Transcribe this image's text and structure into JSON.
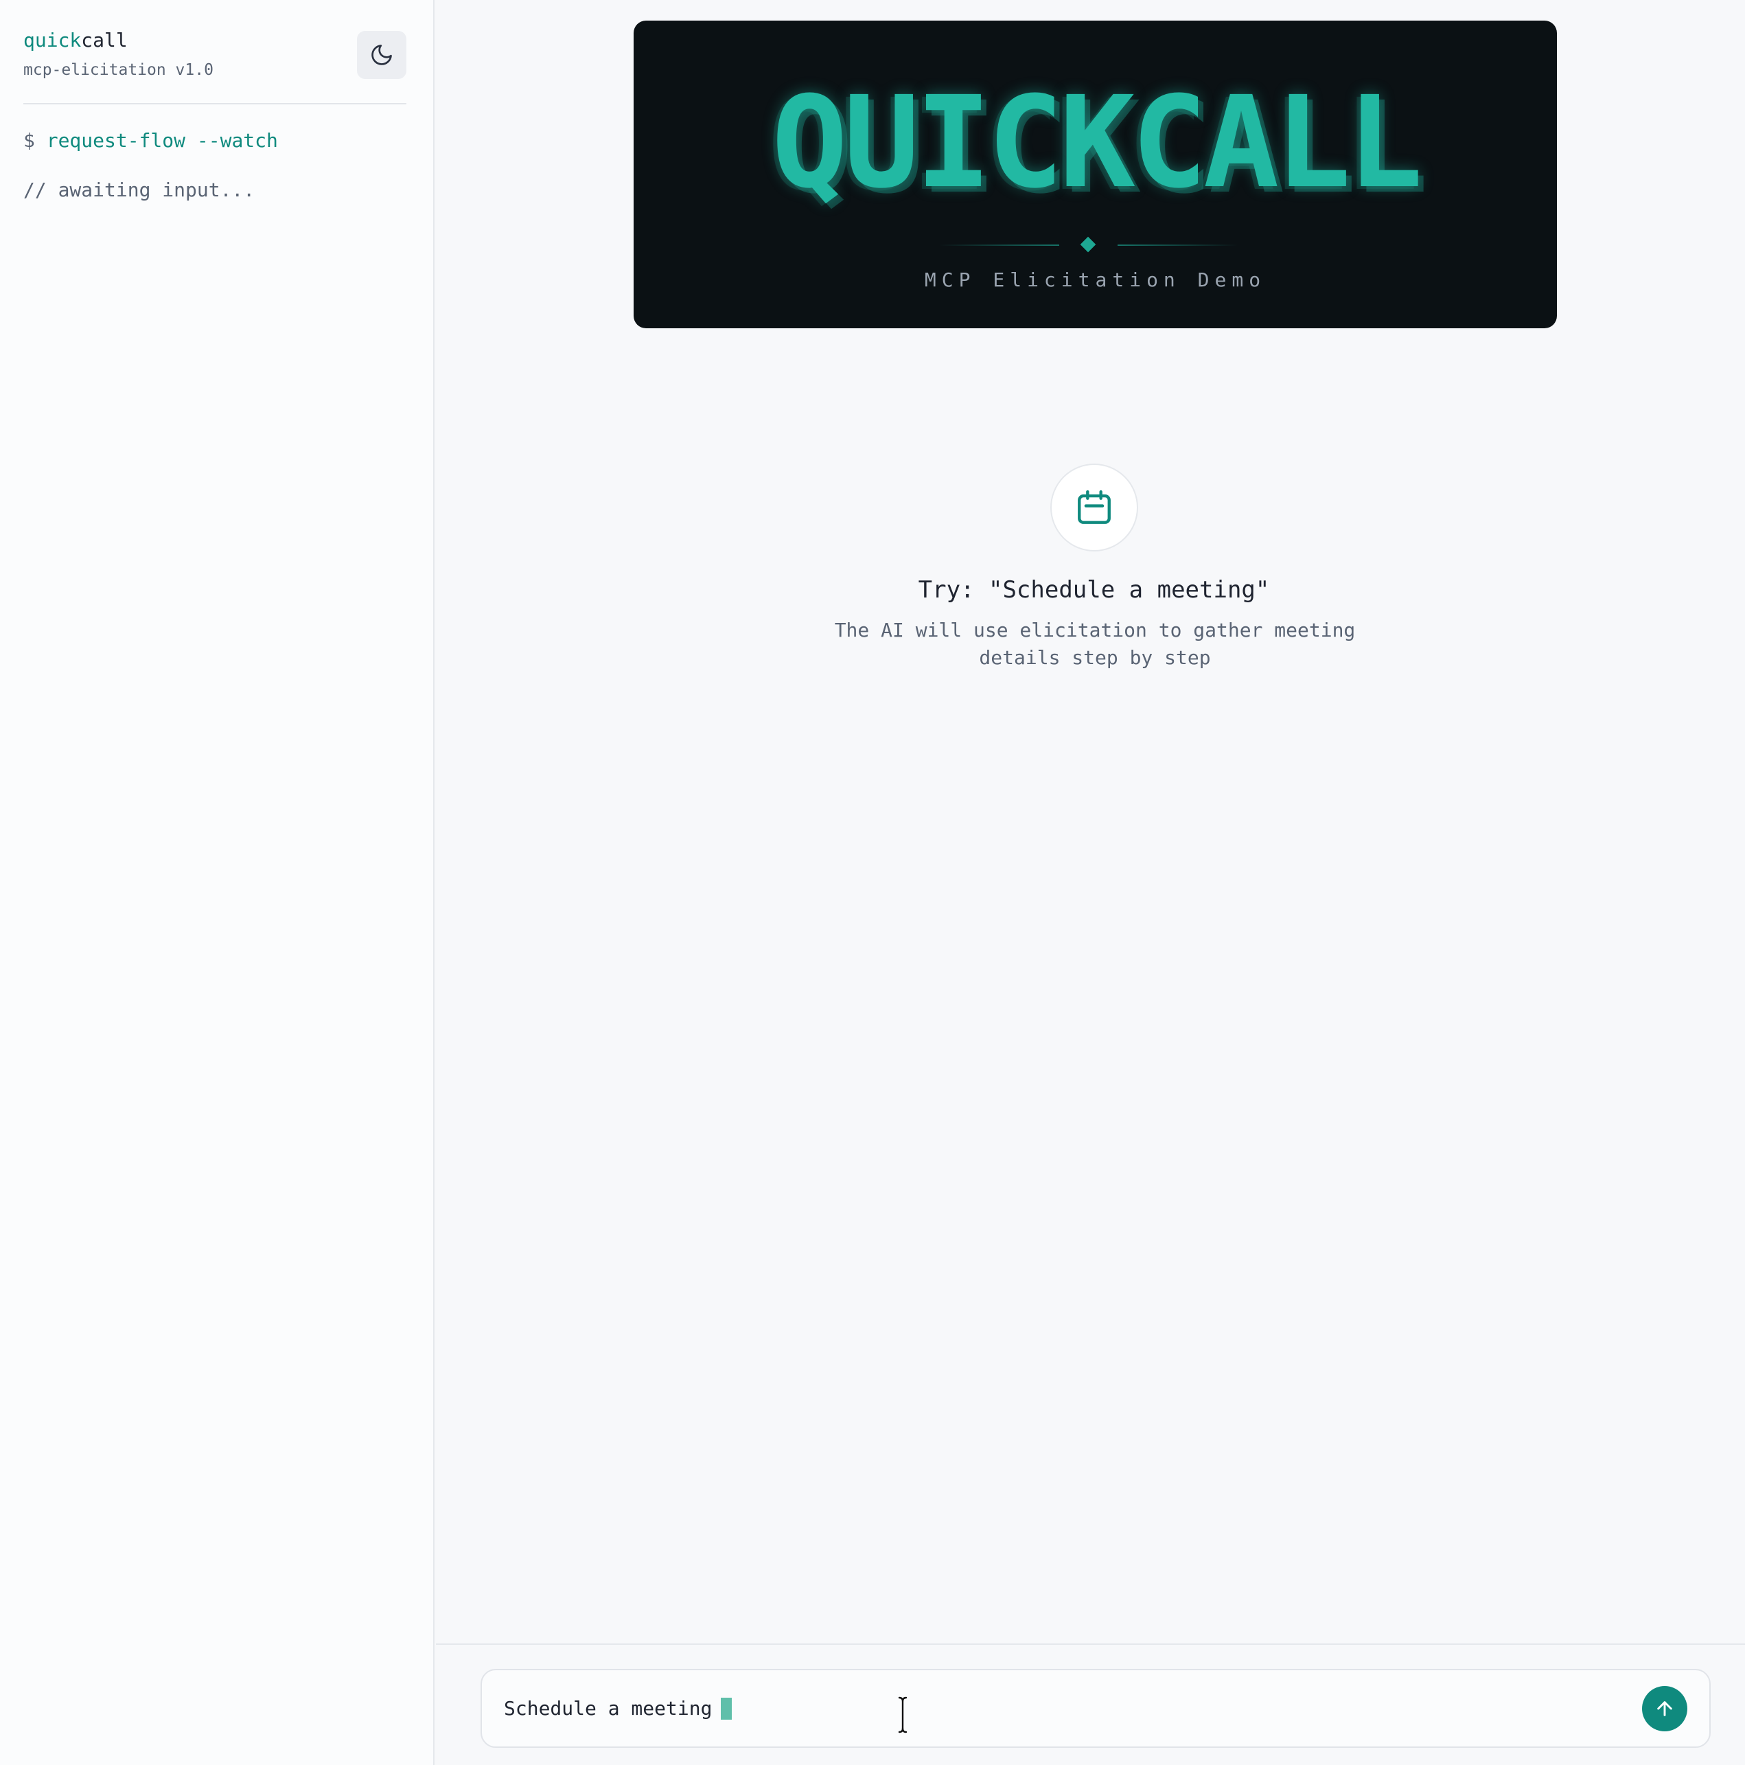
{
  "sidebar": {
    "brand_accent": "quick",
    "brand_rest": "call",
    "version": "mcp-elicitation v1.0",
    "theme_toggle_icon": "moon-icon",
    "command_prompt": "$ ",
    "command": "request-flow --watch",
    "status": "// awaiting input..."
  },
  "banner": {
    "title": "QUICKCALL",
    "subtitle": "MCP Elicitation Demo"
  },
  "empty_state": {
    "icon": "calendar-icon",
    "heading": "Try: \"Schedule a meeting\"",
    "description": "The AI will use elicitation to gather meeting details step by step"
  },
  "composer": {
    "value": "Schedule a meeting",
    "send_icon": "arrow-up-icon"
  },
  "colors": {
    "accent": "#0f8a7e",
    "banner_bg": "#0b1114",
    "banner_text": "#22b9a3"
  }
}
